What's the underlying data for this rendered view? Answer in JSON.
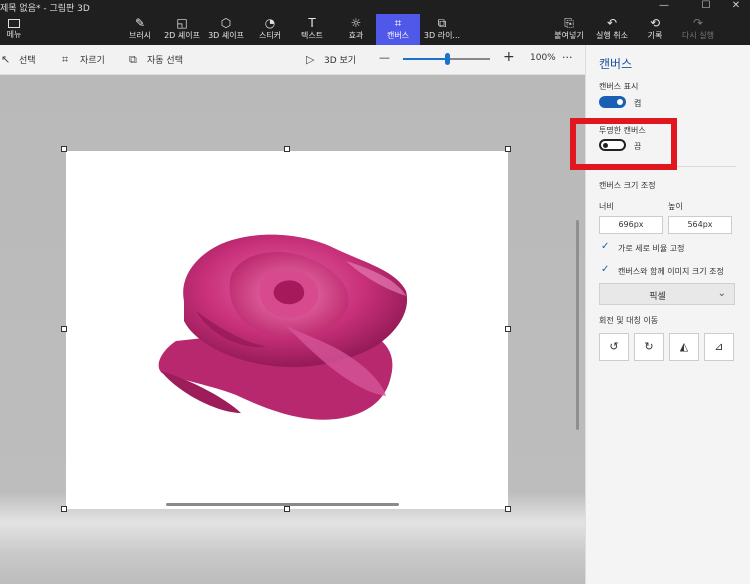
{
  "window": {
    "title": "제목 없음* - 그림판 3D",
    "menu_label": "메뉴",
    "controls": [
      "—",
      "☐",
      "✕"
    ]
  },
  "ribbon": {
    "tools": [
      {
        "label": "브러시",
        "icon": "brush-icon"
      },
      {
        "label": "2D 셰이프",
        "icon": "2d-shapes-icon"
      },
      {
        "label": "3D 셰이프",
        "icon": "3d-shapes-icon"
      },
      {
        "label": "스티커",
        "icon": "sticker-icon"
      },
      {
        "label": "텍스트",
        "icon": "text-icon"
      },
      {
        "label": "효과",
        "icon": "effects-icon"
      },
      {
        "label": "캔버스",
        "icon": "canvas-icon",
        "active": true
      },
      {
        "label": "3D 라이...",
        "icon": "3d-library-icon"
      }
    ],
    "actions": [
      {
        "label": "붙여넣기",
        "icon": "paste-icon"
      },
      {
        "label": "실행 취소",
        "icon": "undo-icon"
      },
      {
        "label": "기록",
        "icon": "history-icon"
      },
      {
        "label": "다시 실행",
        "icon": "redo-icon",
        "disabled": true
      }
    ]
  },
  "subbar": {
    "select_label": "선택",
    "crop_label": "자르기",
    "magic_select_label": "자동 선택",
    "view3d_label": "3D 보기",
    "zoom_minus": "—",
    "zoom_plus": "+",
    "zoom_value": "100%",
    "zoom_fraction": 0.5,
    "more": "···"
  },
  "panel": {
    "title": "캔버스",
    "show_canvas_label": "캔버스 표시",
    "show_canvas_state": "켬",
    "show_canvas_on": true,
    "transparent_canvas_label": "투명한 캔버스",
    "transparent_canvas_state": "끔",
    "transparent_canvas_on": false,
    "resize_heading": "캔버스 크기 조정",
    "width_label": "너비",
    "height_label": "높이",
    "width_value": "696px",
    "height_value": "564px",
    "lock_ratio_label": "가로 세로 비율 고정",
    "lock_ratio_checked": true,
    "resize_image_label": "캔버스와 함께 이미지 크기 조정",
    "resize_image_checked": true,
    "unit_value": "픽셀",
    "rotate_heading": "회전 및 대칭 이동"
  },
  "colors": {
    "accent": "#4f58e8",
    "toggle_on": "#1a5fb4",
    "highlight": "#e0171f",
    "rose": "#c8307a"
  }
}
